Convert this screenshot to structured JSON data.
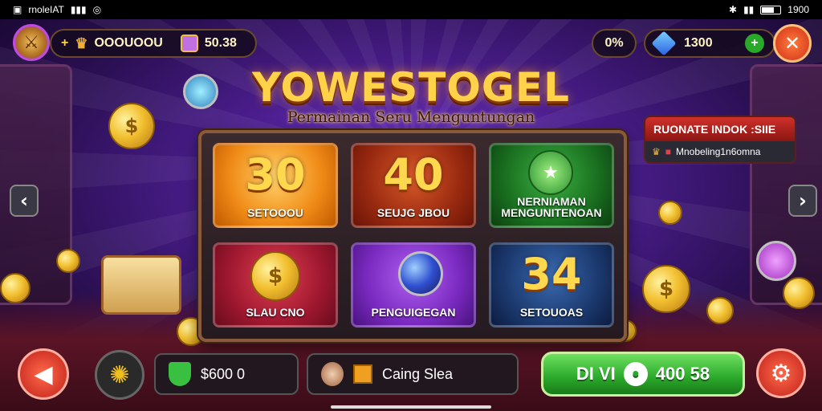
{
  "status_bar": {
    "left_text": "rnoleIAT",
    "time": "1900"
  },
  "hud": {
    "coins_value": "OOOUOOU",
    "gold_value": "50.38",
    "percent": "0%",
    "gems_value": "1300"
  },
  "title": "YOWESTOGEL",
  "subtitle": "Permainan Seru Menguntungan",
  "tiles": [
    {
      "number": "30",
      "label": "SETOOOU"
    },
    {
      "number": "40",
      "label": "SEUJG JBOU"
    },
    {
      "number": "",
      "label": "NERNIAMAN MENGUNITENOAN"
    },
    {
      "number": "",
      "label": "SLAU CNO"
    },
    {
      "number": "",
      "label": "PENGUIGEGAN"
    },
    {
      "number": "34",
      "label": "SETOUOAS"
    }
  ],
  "notice": {
    "title": "RUONATE INDOK :SIIE",
    "body": "Mnobeling1n6omna"
  },
  "bottom": {
    "balance": "$600 0",
    "chat_label": "Caing Slea",
    "play_label": "DI VI",
    "play_value": "400 58"
  },
  "colors": {
    "accent_gold": "#ffd24a",
    "play_green": "#2aa82a",
    "danger_red": "#d0302a"
  }
}
